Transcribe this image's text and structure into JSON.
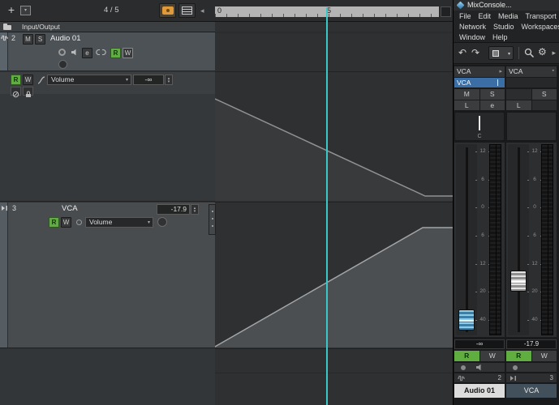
{
  "colors": {
    "playhead_cyan": "#39c7c7",
    "read_green": "#5fae3f",
    "highlight_orange": "#e09a3a",
    "selection_blue": "#3a6ea5",
    "fader_cap_blue": "#3b7ea6"
  },
  "icons": {
    "plus": "+",
    "chevron_down": "▾",
    "chevron_left": "◂",
    "chevron_right": "▸",
    "undo": "↶",
    "redo": "↷",
    "gear": "⚙",
    "spin_up": "▴",
    "spin_down": "▾",
    "record_dot": "●",
    "rack_marker": "▸",
    "rack_square": "▪"
  },
  "project": {
    "toolbar": {
      "counter": "4 / 5"
    },
    "ruler": {
      "label_start": "0",
      "label_mid": "5"
    },
    "io_row": {
      "label": "Input/Output"
    },
    "audio_track": {
      "number": "2",
      "mute": "M",
      "solo": "S",
      "name": "Audio 01",
      "edit_channel": "e",
      "read": "R",
      "write": "W"
    },
    "automation_lane": {
      "read": "R",
      "write": "W",
      "parameter": "Volume",
      "value": "-∞"
    },
    "vca_track": {
      "number": "3",
      "name": "VCA",
      "value": "-17.9",
      "read": "R",
      "write": "W",
      "parameter": "Volume"
    }
  },
  "mixconsole": {
    "window_title": "MixConsole...",
    "menus": [
      "File",
      "Edit",
      "Media",
      "Transport",
      "Network",
      "Studio",
      "Workspaces",
      "Window",
      "Help"
    ],
    "meter_scale": [
      "12",
      "6",
      "0",
      "6",
      "12",
      "20",
      "40"
    ],
    "strips": [
      {
        "vca_rack": "VCA",
        "name_field": "VCA",
        "mute": "M",
        "solo": "S",
        "link": "L",
        "edit": "e",
        "pan": "C",
        "value": "-∞",
        "read": "R",
        "write": "W",
        "number": "2",
        "name": "Audio 01"
      },
      {
        "vca_rack": "VCA",
        "solo": "S",
        "link": "L",
        "value": "-17.9",
        "read": "R",
        "write": "W",
        "number": "3",
        "name": "VCA"
      }
    ]
  }
}
